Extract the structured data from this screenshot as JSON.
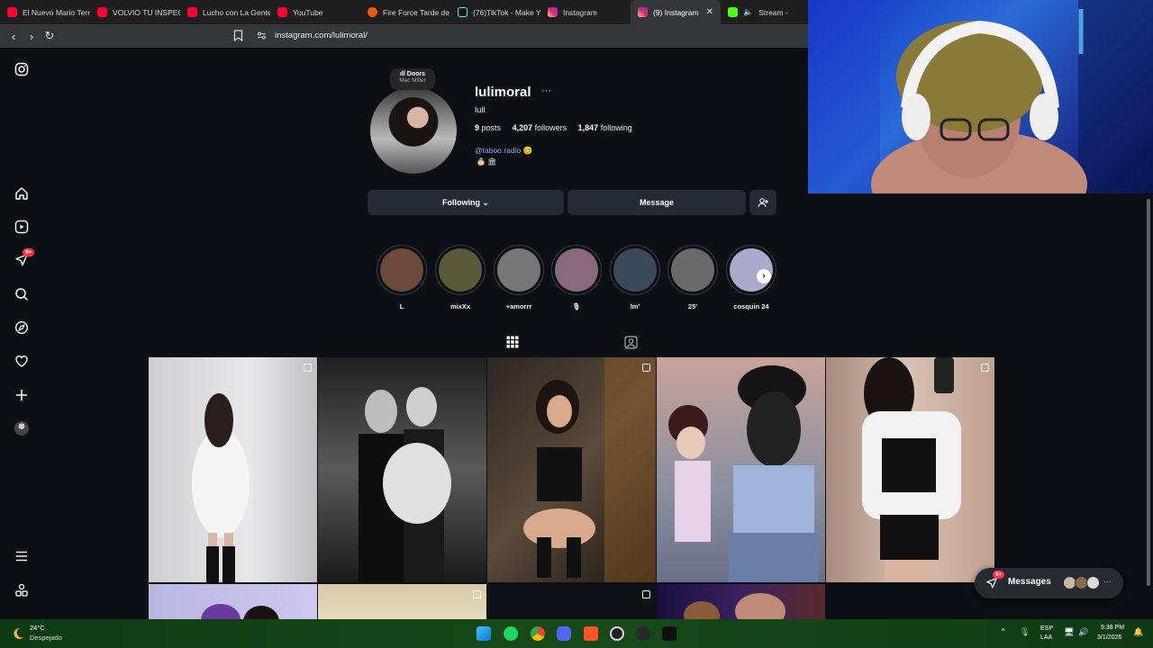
{
  "browser": {
    "tabs": [
      {
        "label": "El Nuevo Mario Terr",
        "icon": "youtube-icon"
      },
      {
        "label": "VOLVIO TU INSPECT",
        "icon": "youtube-icon"
      },
      {
        "label": "Lucho con La Gente",
        "icon": "youtube-icon"
      },
      {
        "label": "YouTube",
        "icon": "youtube-icon"
      },
      {
        "label": "Fire Force Tarde de",
        "icon": "fire-icon"
      },
      {
        "label": "(76)TikTok - Make Y",
        "icon": "tiktok-icon"
      },
      {
        "label": "Instagram",
        "icon": "instagram-icon"
      },
      {
        "label": "(9) Instagram",
        "icon": "instagram-icon",
        "active": true
      },
      {
        "label": "Stream -",
        "icon": "kick-icon"
      }
    ],
    "url": "instagram.com/lulimoral/"
  },
  "profile": {
    "username": "lulimoral",
    "more": "···",
    "full_name": "luli",
    "posts_count": "9",
    "posts_label": "posts",
    "followers_count": "4,207",
    "followers_label": "followers",
    "following_count": "1,847",
    "following_label": "following",
    "bio_link": "@taboo.radio",
    "bio_emoji": "🎂 🏛",
    "note_title": "Doors",
    "note_artist": "Mac Miller"
  },
  "actions": {
    "following": "Following ⌄",
    "message": "Message"
  },
  "highlights": [
    {
      "label": "L",
      "color": "#6b4a3a"
    },
    {
      "label": "mixXx",
      "color": "#5a5a3a"
    },
    {
      "label": "+amorrr",
      "color": "#777777"
    },
    {
      "label": "🎙",
      "color": "#8a6a7a"
    },
    {
      "label": "lm'",
      "color": "#3a4a5a"
    },
    {
      "label": "25'",
      "color": "#6a6a6a"
    },
    {
      "label": "cosquin 24",
      "color": "#aaaacc"
    }
  ],
  "sidebar": {
    "notifications_badge": "9+"
  },
  "messages": {
    "label": "Messages",
    "badge": "9+",
    "more": "···"
  },
  "taskbar": {
    "temperature": "24°C",
    "condition": "Despejado",
    "lang1": "ESP",
    "lang2": "LAA",
    "time": "9:38 PM",
    "date": "3/1/2026"
  }
}
